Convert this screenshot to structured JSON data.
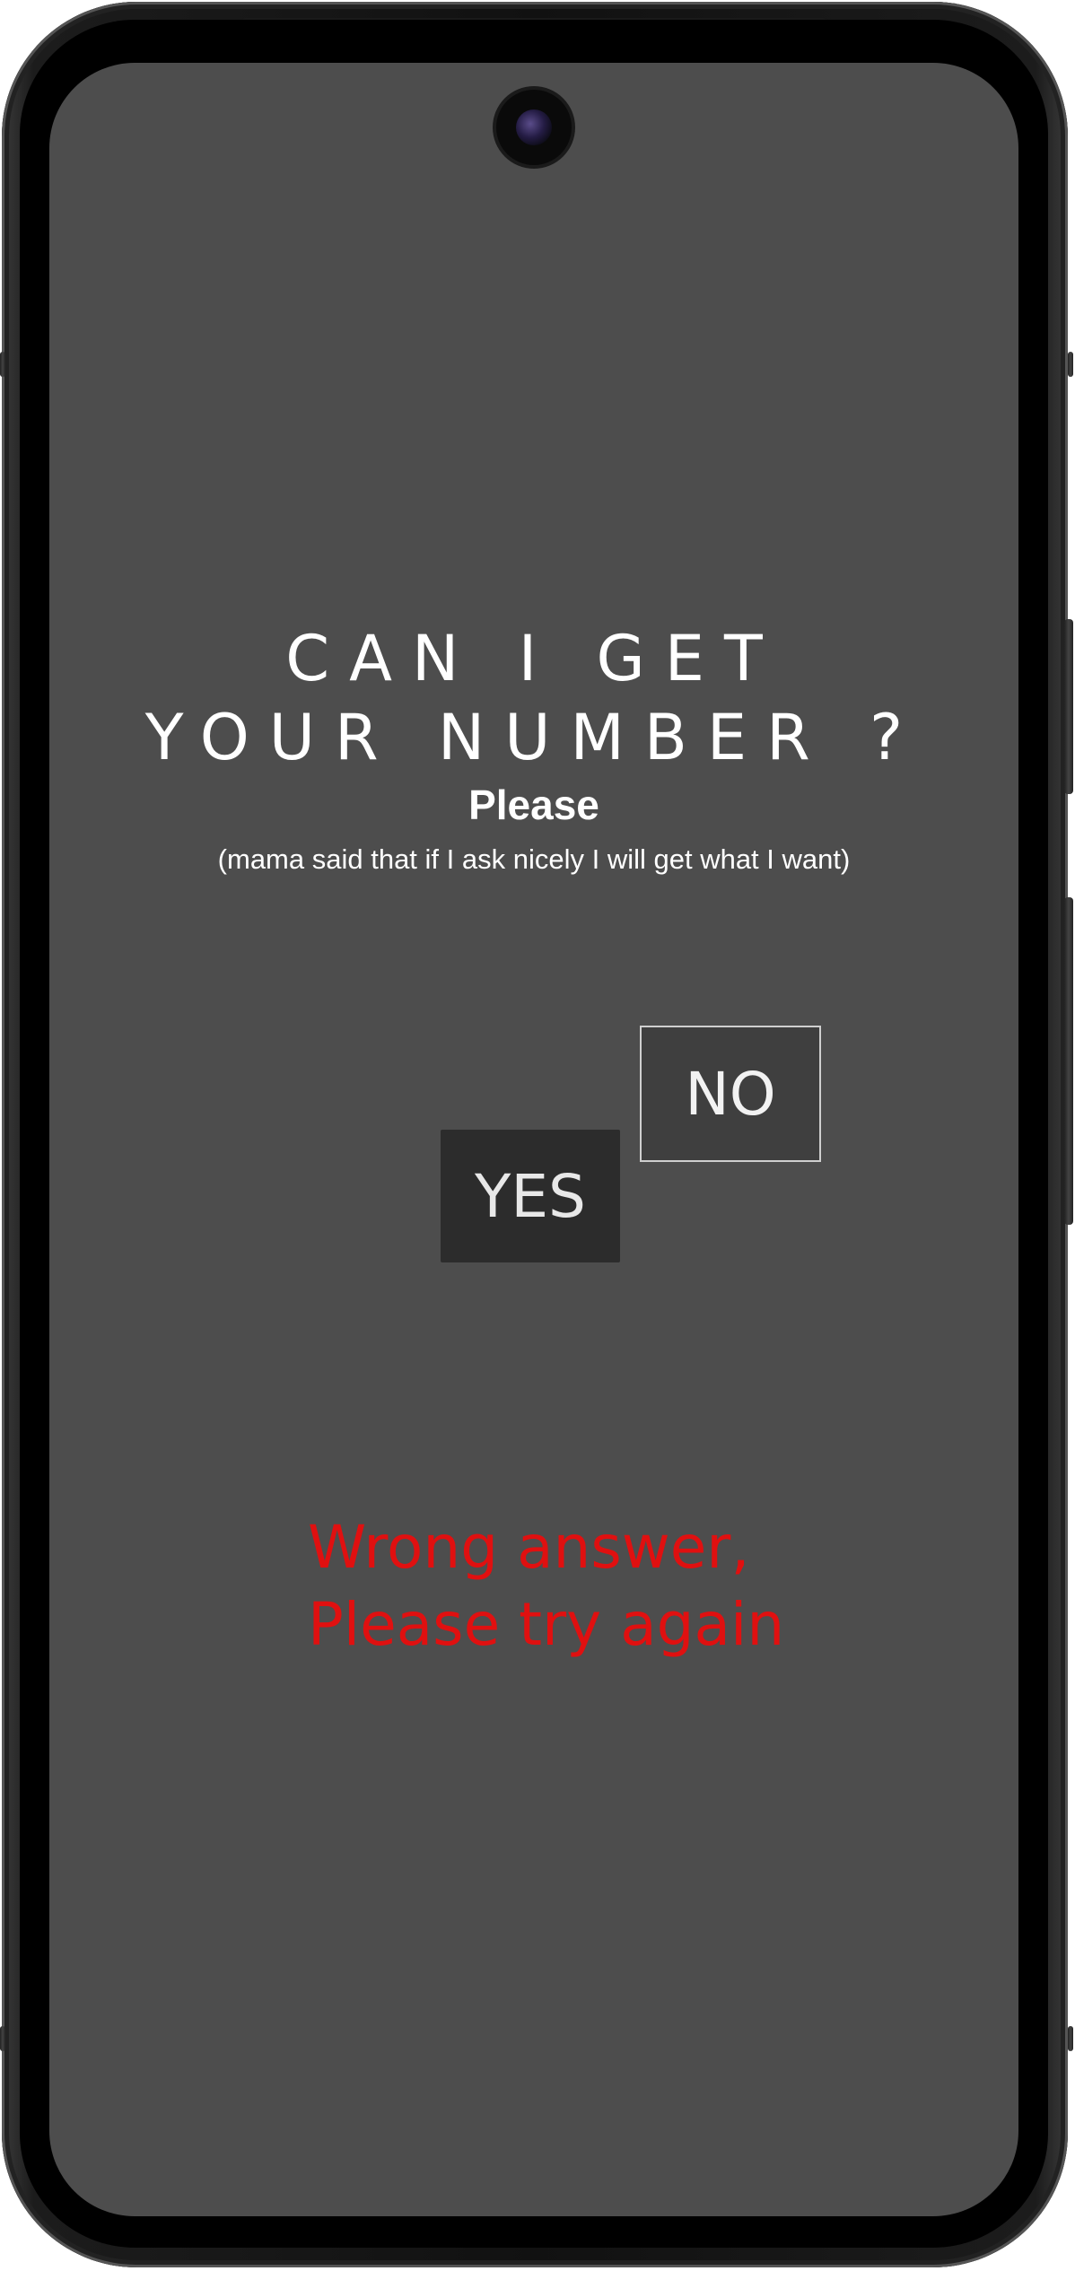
{
  "app": {
    "title_line1": "CAN I GET",
    "title_line2": "YOUR NUMBER ?",
    "please_label": "Please",
    "subtext": "(mama said that if I ask nicely I will get what I want)"
  },
  "buttons": {
    "no_label": "NO",
    "yes_label": "YES"
  },
  "error": {
    "line1": "Wrong answer,",
    "line2": "Please try again",
    "color": "#e01010"
  },
  "theme": {
    "screen_background": "#4d4d4d",
    "yes_button_background": "#2c2c2c",
    "no_button_background": "#3f3f3f",
    "text_color": "#ffffff"
  },
  "device": {
    "camera_icon": "front-camera-icon"
  }
}
